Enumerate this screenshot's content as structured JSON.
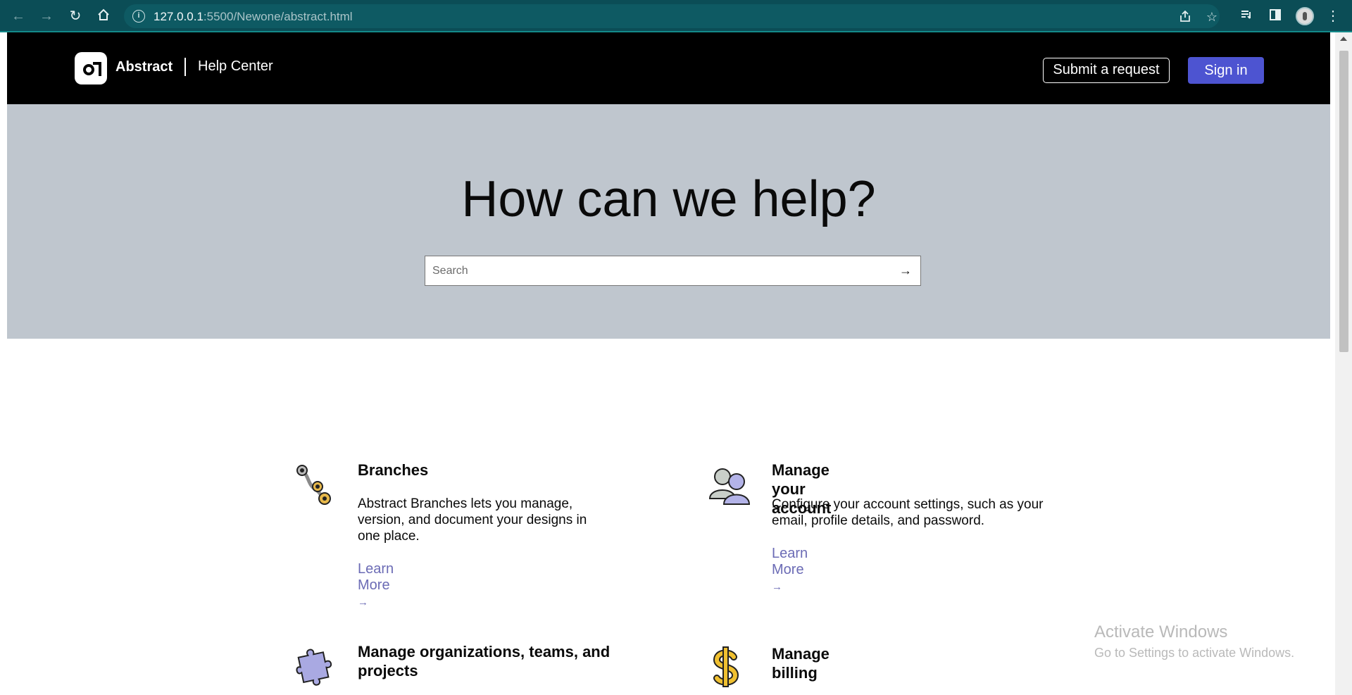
{
  "browser": {
    "url_host": "127.0.0.1",
    "url_rest": ":5500/Newone/abstract.html",
    "icons": [
      "back-arrow-icon",
      "forward-arrow-icon",
      "reload-icon",
      "home-icon",
      "site-info-icon",
      "share-icon",
      "bookmark-star-icon",
      "reading-list-icon",
      "side-panel-icon",
      "profile-avatar",
      "more-menu-icon"
    ]
  },
  "header": {
    "brand": "Abstract",
    "section": "Help Center",
    "submit_label": "Submit a request",
    "signin_label": "Sign in",
    "colors": {
      "background": "#000000",
      "signin": "#4d54d1"
    }
  },
  "hero": {
    "title": "How can we help?",
    "search_placeholder": "Search",
    "background": "#bfc6ce"
  },
  "cards": [
    {
      "title": "Branches",
      "description": "Abstract Branches lets you manage, version, and document your designs in one place.",
      "link": "Learn More",
      "link_arrow": "→",
      "icon": "branches-icon"
    },
    {
      "title": "Manage your account",
      "description": "Configure your account settings, such as your email, profile details, and password.",
      "link": "Learn More",
      "link_arrow": "→",
      "icon": "users-icon"
    },
    {
      "title": "Manage organizations, teams, and projects",
      "icon": "puzzle-piece-icon"
    },
    {
      "title": "Manage billing",
      "icon": "dollar-icon"
    }
  ],
  "watermark": {
    "title": "Activate Windows",
    "subtitle": "Go to Settings to activate Windows."
  },
  "colors": {
    "link": "#6b6bb5"
  }
}
